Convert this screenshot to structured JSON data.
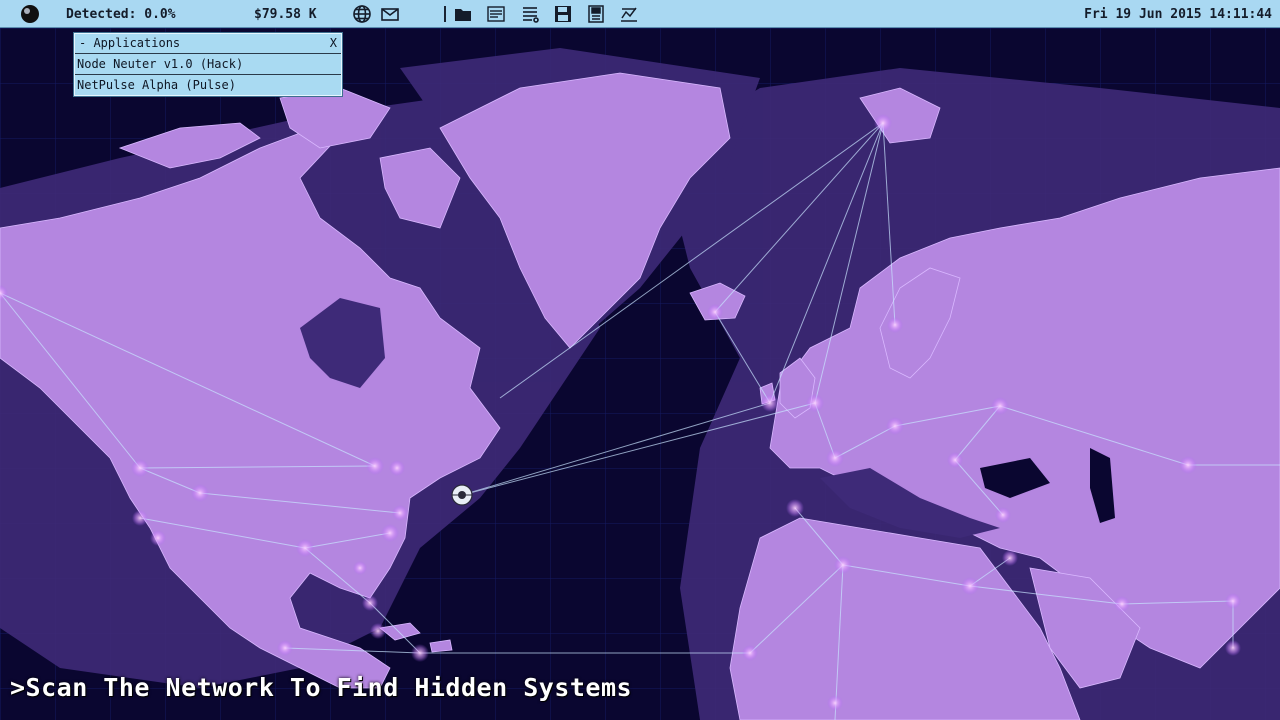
{
  "topbar": {
    "detected": "Detected: 0.0%",
    "money": "$79.58 K",
    "datetime": "Fri 19 Jun 2015 14:11:44",
    "icons": [
      "system-orb-icon",
      "globe-icon",
      "mail-icon",
      "folder-icon",
      "log-viewer-icon",
      "task-list-icon",
      "save-disk-icon",
      "notes-icon",
      "stats-icon"
    ]
  },
  "applications": {
    "title": "- Applications",
    "close": "X",
    "items": [
      "Node Neuter v1.0 (Hack)",
      "NetPulse Alpha (Pulse)"
    ]
  },
  "objective": ">Scan The Network To Find Hidden Systems",
  "colors": {
    "ocean": "#0a0630",
    "land": "#b486e0",
    "land_dark": "#5b3f9c",
    "topbar": "#a9d8f2",
    "link": "#c9e4ff",
    "node": "#e0a8ff"
  }
}
